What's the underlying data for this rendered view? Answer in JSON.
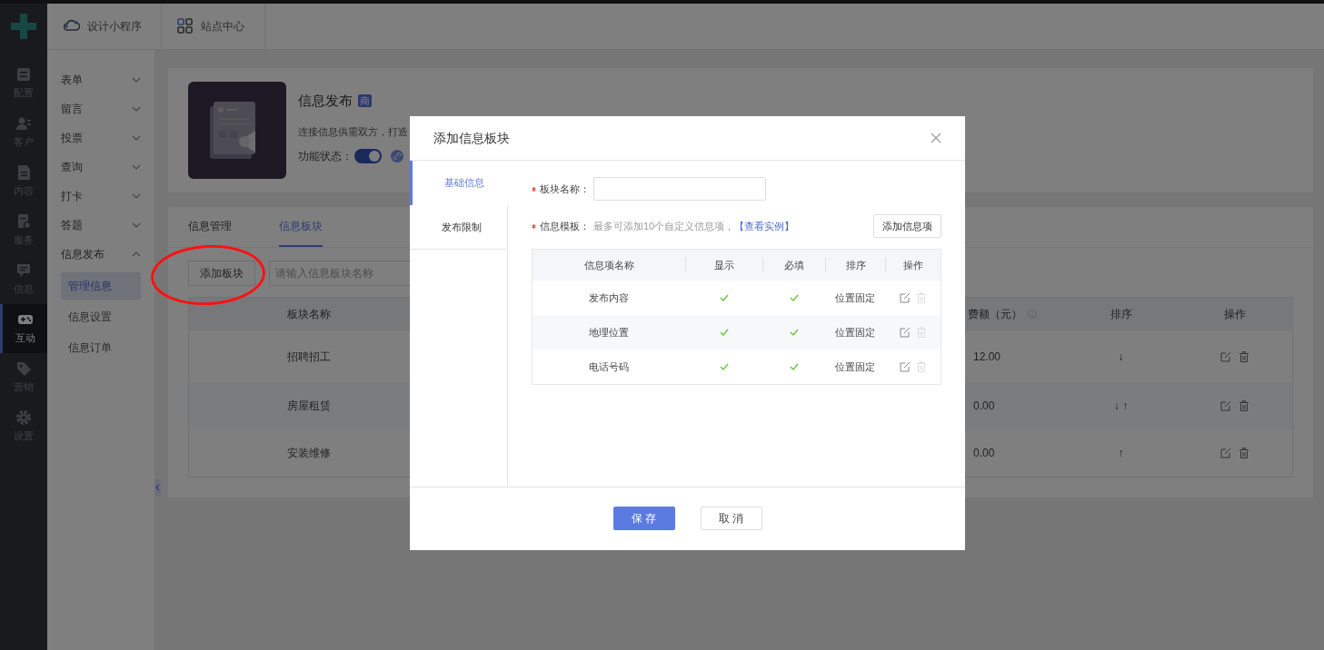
{
  "rail": {
    "items": [
      {
        "label": "配置",
        "selected": false
      },
      {
        "label": "客户",
        "selected": false
      },
      {
        "label": "内容",
        "selected": false
      },
      {
        "label": "服务",
        "selected": false
      },
      {
        "label": "信息",
        "selected": false
      },
      {
        "label": "互动",
        "selected": true
      },
      {
        "label": "营销",
        "selected": false
      },
      {
        "label": "设置",
        "selected": false
      }
    ]
  },
  "topbar": {
    "items": [
      {
        "label": "设计小程序"
      },
      {
        "label": "站点中心"
      }
    ]
  },
  "submenu": {
    "items": [
      {
        "label": "表单",
        "expanded": false
      },
      {
        "label": "留言",
        "expanded": false
      },
      {
        "label": "投票",
        "expanded": false
      },
      {
        "label": "查询",
        "expanded": false
      },
      {
        "label": "打卡",
        "expanded": false
      },
      {
        "label": "答题",
        "expanded": false
      },
      {
        "label": "信息发布",
        "expanded": true,
        "children": [
          {
            "label": "管理信息",
            "selected": true
          },
          {
            "label": "信息设置",
            "selected": false
          },
          {
            "label": "信息订单",
            "selected": false
          }
        ]
      }
    ]
  },
  "app_card": {
    "title": "信息发布",
    "badge": "商",
    "description": "连接信息供需双方，打造",
    "status_label": "功能状态：",
    "status_on": true
  },
  "tabs": [
    {
      "label": "信息管理",
      "selected": false
    },
    {
      "label": "信息板块",
      "selected": true
    }
  ],
  "toolbar": {
    "add_button": "添加板块",
    "search": {
      "placeholder": "请输入信息板块名称"
    }
  },
  "table": {
    "columns": [
      "板块名称",
      "费额（元）",
      "排序",
      "操作"
    ],
    "rows": [
      {
        "name": "招聘招工",
        "price": "12.00",
        "sort": "↓"
      },
      {
        "name": "房屋租赁",
        "price": "0.00",
        "sort": "↓ ↑"
      },
      {
        "name": "安装维修",
        "price": "0.00",
        "sort": "↑"
      }
    ]
  },
  "modal": {
    "title": "添加信息板块",
    "tabs": [
      {
        "label": "基础信息",
        "selected": true
      },
      {
        "label": "发布限制",
        "selected": false
      }
    ],
    "name_field": {
      "label": "板块名称：",
      "required": true
    },
    "template": {
      "label": "信息模板：",
      "required": true,
      "hint": "最多可添加10个自定义信息项，",
      "link": "【查看实例】",
      "add_button": "添加信息项"
    },
    "items_table": {
      "columns": [
        "信息项名称",
        "显示",
        "必填",
        "排序",
        "操作"
      ],
      "rows": [
        {
          "name": "发布内容",
          "shown": true,
          "required": true,
          "sort": "位置固定",
          "delete_disabled": true
        },
        {
          "name": "地理位置",
          "shown": true,
          "required": true,
          "sort": "位置固定",
          "delete_disabled": true
        },
        {
          "name": "电话号码",
          "shown": true,
          "required": true,
          "sort": "位置固定",
          "delete_disabled": true
        }
      ]
    },
    "buttons": {
      "save": "保 存",
      "cancel": "取 消"
    }
  }
}
